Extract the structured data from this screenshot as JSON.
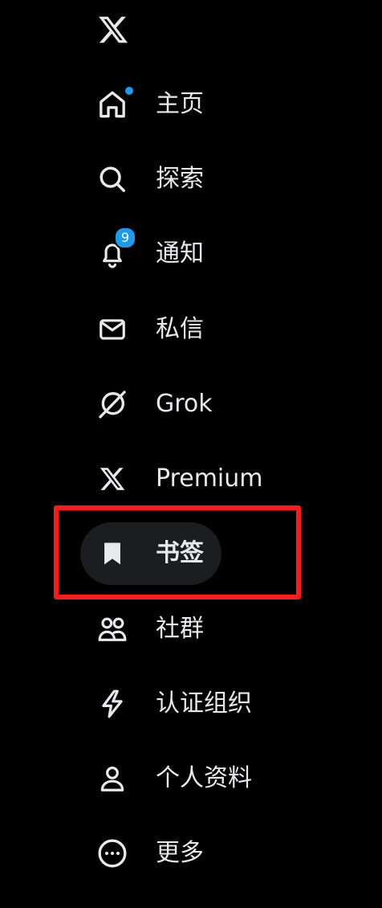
{
  "logo": {
    "icon": "x-logo-icon"
  },
  "nav": {
    "items": [
      {
        "id": "home",
        "label": "主页",
        "icon": "home-icon",
        "has_dot": true
      },
      {
        "id": "explore",
        "label": "探索",
        "icon": "search-icon"
      },
      {
        "id": "notifications",
        "label": "通知",
        "icon": "bell-icon",
        "badge": "9"
      },
      {
        "id": "messages",
        "label": "私信",
        "icon": "envelope-icon"
      },
      {
        "id": "grok",
        "label": "Grok",
        "icon": "grok-icon"
      },
      {
        "id": "premium",
        "label": "Premium",
        "icon": "x-logo-icon"
      },
      {
        "id": "bookmarks",
        "label": "书签",
        "icon": "bookmark-icon",
        "active": true
      },
      {
        "id": "communities",
        "label": "社群",
        "icon": "people-icon"
      },
      {
        "id": "verified_orgs",
        "label": "认证组织",
        "icon": "lightning-icon"
      },
      {
        "id": "profile",
        "label": "个人资料",
        "icon": "person-icon"
      },
      {
        "id": "more",
        "label": "更多",
        "icon": "more-circle-icon"
      }
    ]
  },
  "colors": {
    "background": "#000000",
    "text": "#e7e9ea",
    "accent": "#1d9bf0",
    "active_bg": "#1c1d20",
    "highlight_border": "#ff1a1a"
  }
}
